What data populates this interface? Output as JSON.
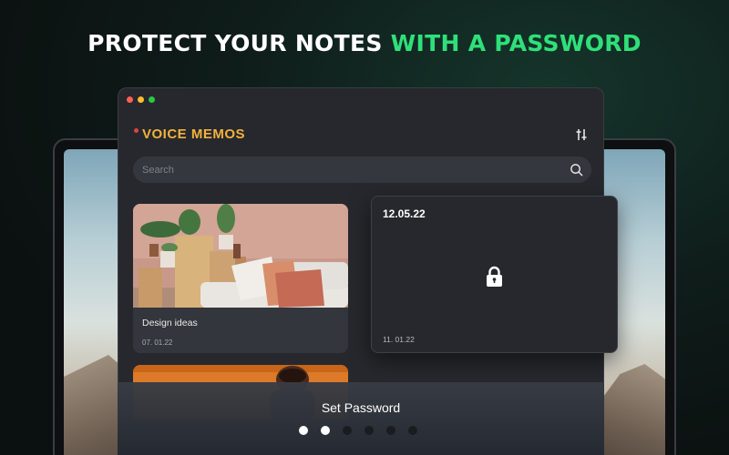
{
  "headline": {
    "main": "PROTECT YOUR NOTES",
    "accent": "WITH A PASSWORD"
  },
  "colors": {
    "accent": "#2fe07a",
    "title": "#f3b23c",
    "record_dot": "#e0443b"
  },
  "app": {
    "title": "VOICE MEMOS",
    "search": {
      "placeholder": "Search",
      "value": ""
    },
    "icons": {
      "settings": "sliders-icon",
      "search": "search-icon"
    }
  },
  "notes": [
    {
      "title": "Design ideas",
      "date": "07. 01.22",
      "image": "living-room-photo"
    },
    {
      "title": "",
      "date": "",
      "image": "portrait-photo-orange"
    }
  ],
  "locked_note": {
    "header": "12.05.22",
    "date": "11. 01.22",
    "icon": "lock-icon"
  },
  "onboarding": {
    "label": "Set Password",
    "pages": 6,
    "active_pages": 2
  }
}
